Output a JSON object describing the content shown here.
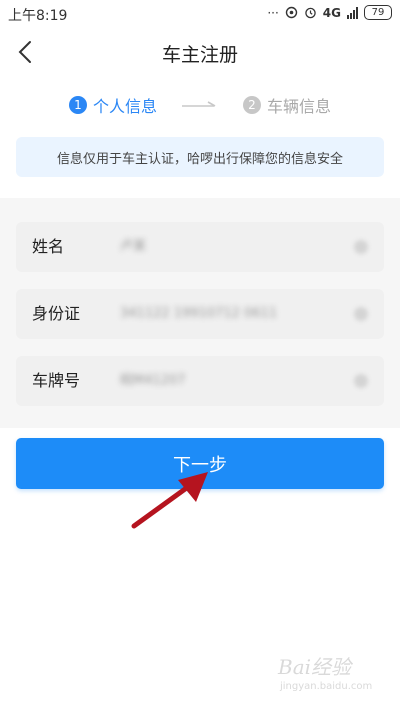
{
  "status_bar": {
    "time": "上午8:19",
    "network": "4G",
    "battery": "79"
  },
  "nav": {
    "title": "车主注册"
  },
  "steps": [
    {
      "num": "1",
      "label": "个人信息"
    },
    {
      "num": "2",
      "label": "车辆信息"
    }
  ],
  "notice": "信息仅用于车主认证，哈啰出行保障您的信息安全",
  "form": {
    "rows": [
      {
        "label": "姓名",
        "value": "卢某"
      },
      {
        "label": "身份证",
        "value": "341122 19910712 0611"
      },
      {
        "label": "车牌号",
        "value": "皖M41207"
      }
    ]
  },
  "next_button": "下一步",
  "watermark": {
    "text": "Bai经验",
    "url": "jingyan.baidu.com"
  },
  "colors": {
    "accent": "#1d8cf8",
    "notice_bg": "#eaf4ff",
    "annotation_arrow": "#b5141f"
  },
  "icons": {
    "back": "back-chevron-icon",
    "step_arrow": "long-arrow-right-icon",
    "clear": "clear-circle-icon"
  }
}
